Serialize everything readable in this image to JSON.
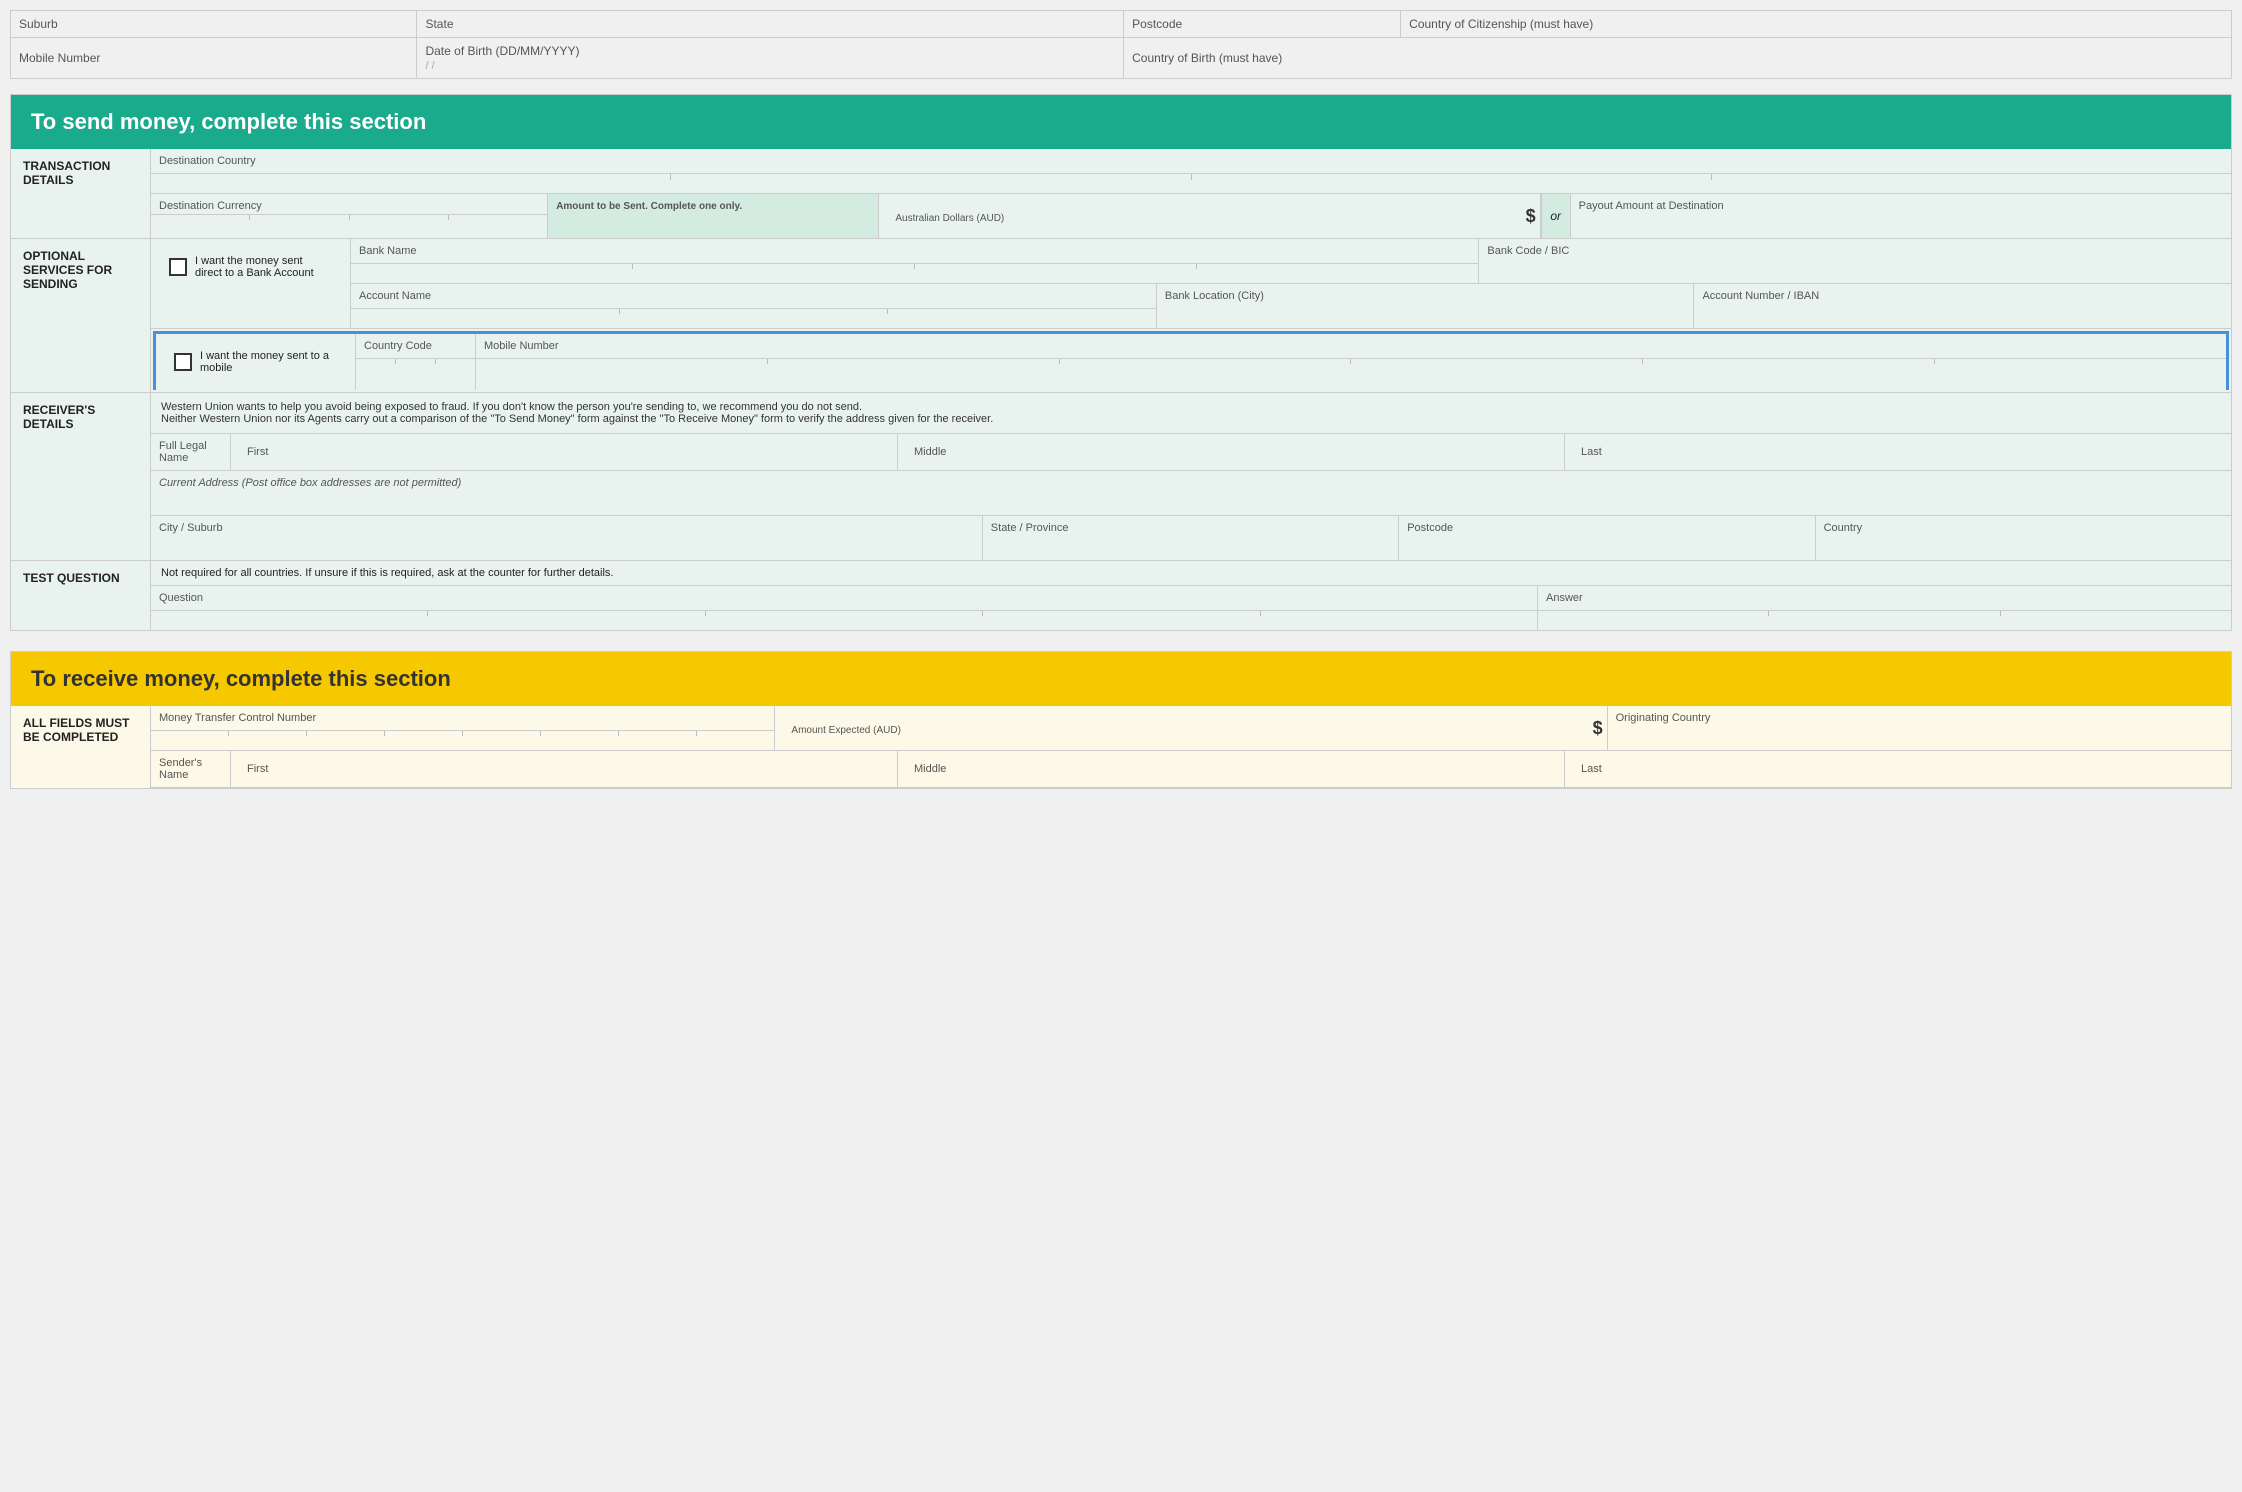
{
  "topTable": {
    "row1": {
      "suburb": "Suburb",
      "state": "State",
      "postcode": "Postcode",
      "citizenship": "Country of Citizenship (must have)"
    },
    "row2": {
      "mobile": "Mobile Number",
      "dob": "Date of Birth (DD/MM/YYYY)",
      "dob_sep1": "/",
      "dob_sep2": "/",
      "country_birth": "Country of Birth (must have)"
    }
  },
  "sendSection": {
    "header": "To send money, complete this section",
    "transactionDetails": {
      "label": "TRANSACTION DETAILS",
      "destinationCountry": "Destination Country",
      "destinationCurrency": "Destination Currency",
      "amountLabel": "Amount to be Sent. Complete one only.",
      "audLabel": "Australian Dollars (AUD)",
      "dollarSign": "$",
      "orLabel": "or",
      "payoutLabel": "Payout Amount at Destination"
    },
    "optionalServices": {
      "label": "OPTIONAL SERVICES FOR SENDING",
      "bankCheckboxLabel": "I want the money sent direct to a Bank Account",
      "bankName": "Bank Name",
      "bankCode": "Bank Code / BIC",
      "accountName": "Account Name",
      "bankLocation": "Bank Location (City)",
      "accountNumber": "Account Number / IBAN",
      "mobileCheckboxLabel": "I want the money sent to a mobile",
      "countryCode": "Country Code",
      "mobileNumber": "Mobile Number"
    },
    "receiversDetails": {
      "label": "RECEIVER'S DETAILS",
      "fraudNotice1": "Western Union wants to help you avoid being exposed to fraud. If you don't know the person you're sending to, we recommend you do not send.",
      "fraudNotice2": "Neither Western Union nor its Agents carry out a comparison of the \"To Send Money\" form against the \"To Receive Money\" form to verify the address given for the receiver.",
      "fullLegalName": "Full Legal Name",
      "first": "First",
      "middle": "Middle",
      "last": "Last",
      "currentAddress": "Current Address (Post office box addresses are not permitted)",
      "citySuburb": "City / Suburb",
      "stateProvince": "State / Province",
      "postcode": "Postcode",
      "country": "Country"
    },
    "testQuestion": {
      "label": "TEST QUESTION",
      "note": "Not required for all countries. If unsure if this is required, ask at the counter for further details.",
      "question": "Question",
      "answer": "Answer"
    }
  },
  "receiveSection": {
    "header": "To receive money, complete this section",
    "allFieldsLabel": "All fields must be completed",
    "controlNumber": "Money Transfer Control Number",
    "amountExpected": "Amount Expected (AUD)",
    "dollarSign": "$",
    "originatingCountry": "Originating Country",
    "sendersName": "Sender's Name",
    "first": "First",
    "middle": "Middle",
    "last": "Last"
  }
}
